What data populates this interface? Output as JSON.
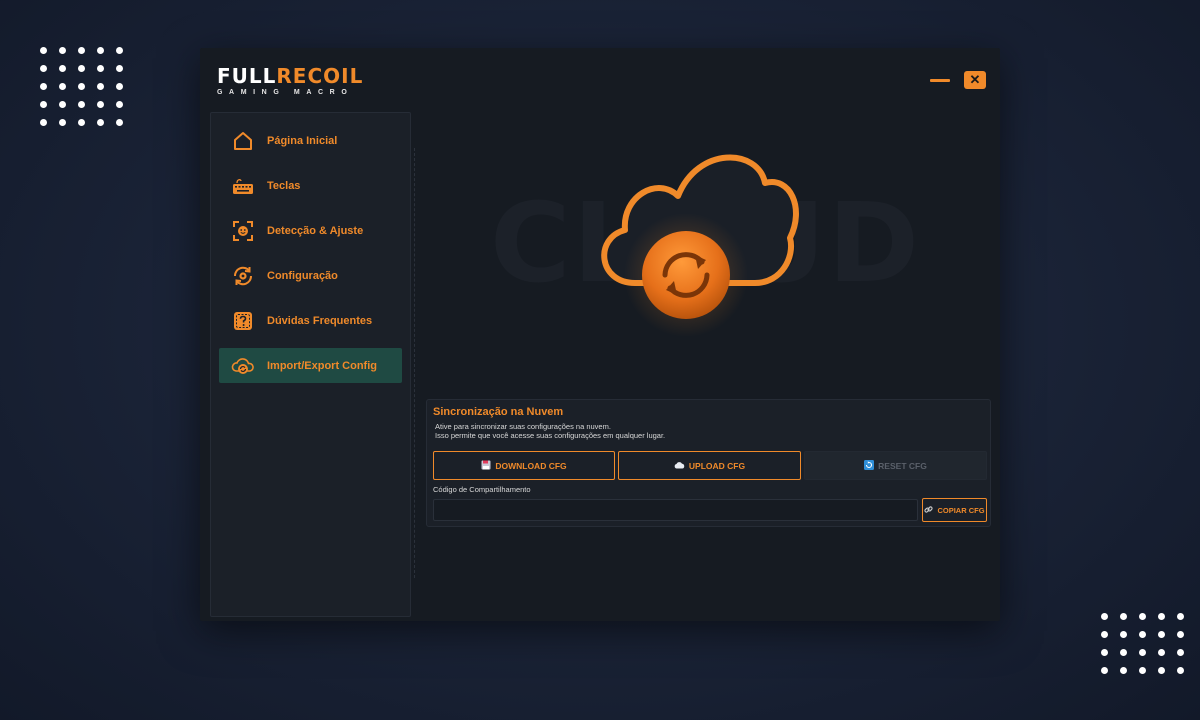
{
  "app": {
    "logo_white": "FULL",
    "logo_orange": "RECOIL",
    "logo_subtitle": "GAMING MACRO",
    "close_glyph": "✕"
  },
  "colors": {
    "accent": "#f08a2a",
    "active_bg": "#1f4a43",
    "window_bg": "#161b22",
    "panel_bg": "#1b2028"
  },
  "sidebar": {
    "items": [
      {
        "label": "Página Inicial",
        "icon": "home-icon",
        "active": false
      },
      {
        "label": "Teclas",
        "icon": "keyboard-icon",
        "active": false
      },
      {
        "label": "Detecção & Ajuste",
        "icon": "face-detect-icon",
        "active": false
      },
      {
        "label": "Configuração",
        "icon": "settings-sync-icon",
        "active": false
      },
      {
        "label": "Dúvidas Frequentes",
        "icon": "question-icon",
        "active": false
      },
      {
        "label": "Import/Export Config",
        "icon": "cloud-sync-icon",
        "active": true
      }
    ]
  },
  "hero": {
    "watermark": "CLOUD",
    "icon": "cloud-sync-icon"
  },
  "sync_panel": {
    "title": "Sincronização na Nuvem",
    "desc_line1": "Ative para sincronizar suas configurações na nuvem.",
    "desc_line2": "Isso permite que você acesse suas configurações em qualquer lugar.",
    "download_label": "DOWNLOAD CFG",
    "upload_label": "UPLOAD CFG",
    "reset_label": "RESET CFG",
    "share_label": "Código de Compartilhamento",
    "share_value": "",
    "share_placeholder": "",
    "copy_label": "COPIAR CFG"
  }
}
